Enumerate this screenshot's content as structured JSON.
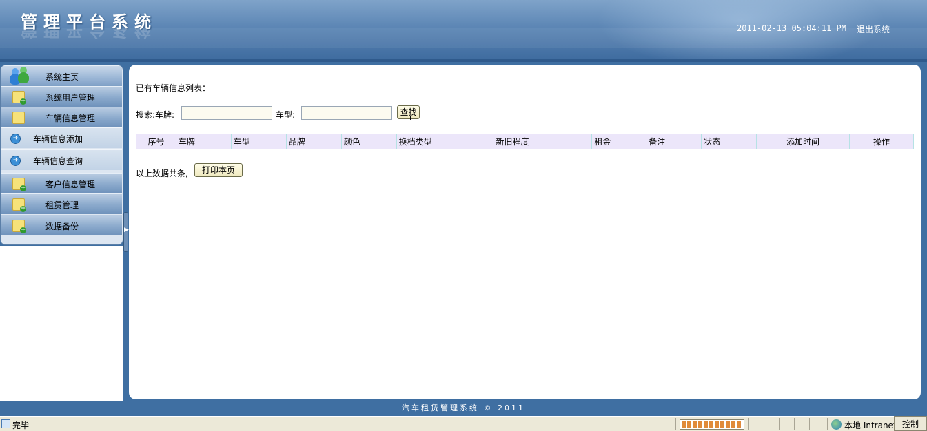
{
  "header": {
    "title": "管理平台系统",
    "datetime": "2011-02-13 05:04:11 PM",
    "logout_label": "退出系统"
  },
  "sidebar": {
    "items": [
      {
        "label": "系统主页",
        "icon": "users-icon"
      },
      {
        "label": "系统用户管理",
        "icon": "folder-add-icon"
      },
      {
        "label": "车辆信息管理",
        "icon": "folder-icon"
      },
      {
        "label": "车辆信息添加",
        "icon": "arrow-right-icon"
      },
      {
        "label": "车辆信息查询",
        "icon": "arrow-right-icon"
      },
      {
        "label": "客户信息管理",
        "icon": "folder-add-icon"
      },
      {
        "label": "租赁管理",
        "icon": "folder-add-icon"
      },
      {
        "label": "数据备份",
        "icon": "folder-add-icon"
      }
    ],
    "toggle_icon": "chevron-right-icon"
  },
  "main": {
    "list_title": "已有车辆信息列表：",
    "search": {
      "label": "搜索:车牌:",
      "plate_value": "",
      "type_label": "车型:",
      "type_value": "",
      "button_label": "查找"
    },
    "table": {
      "columns": [
        "序号",
        "车牌",
        "车型",
        "品牌",
        "颜色",
        "换档类型",
        "新旧程度",
        "租金",
        "备注",
        "状态",
        "添加时间",
        "操作"
      ],
      "rows": []
    },
    "summary_label": "以上数据共条,",
    "print_button_label": "打印本页"
  },
  "footer": {
    "text": "汽车租赁管理系统 © 2011"
  },
  "statusbar": {
    "status_text": "完毕",
    "zone_text": "本地 Intranet",
    "control_label": "控制",
    "progress_percent": 100
  },
  "colors": {
    "page_background": "#3f6fa2",
    "table_header_bg": "#ece6fa",
    "table_border": "#7fd1d6",
    "button_bg": "#efe9bf"
  }
}
